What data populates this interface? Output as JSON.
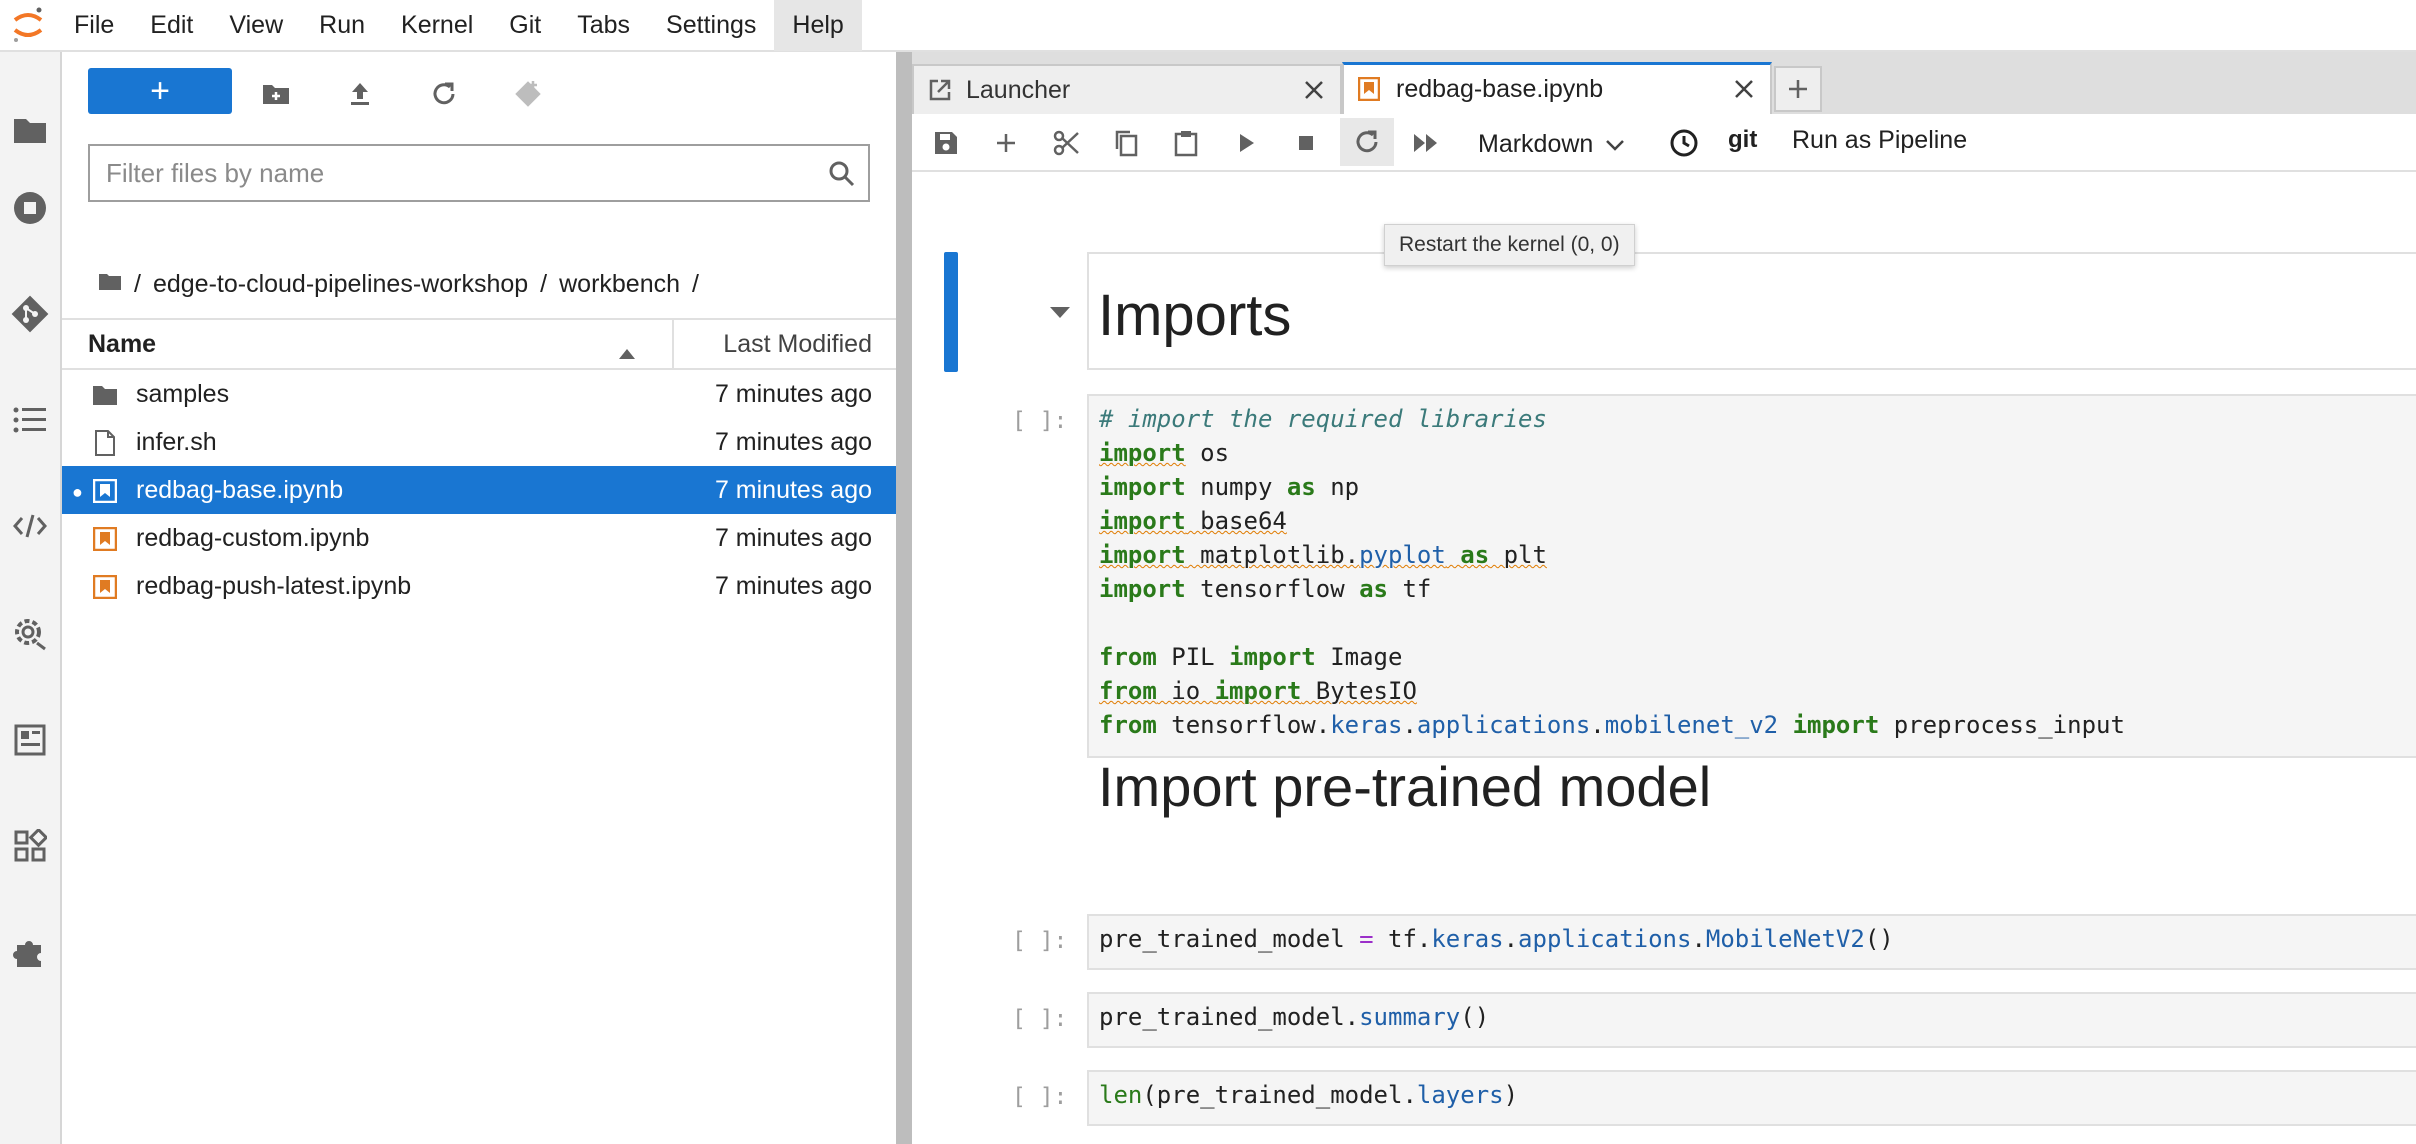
{
  "menubar": {
    "items": [
      "File",
      "Edit",
      "View",
      "Run",
      "Kernel",
      "Git",
      "Tabs",
      "Settings",
      "Help"
    ],
    "active": "Help"
  },
  "activitybar": {
    "icons": [
      "folder-icon",
      "stop-circle-icon",
      "git-icon",
      "list-icon",
      "code-icon",
      "settings-gear-icon",
      "component-catalog-icon",
      "pipeline-components-icon",
      "extension-puzzle-icon"
    ]
  },
  "filebrowser": {
    "new_label": "+",
    "filter_placeholder": "Filter files by name",
    "breadcrumb": [
      "edge-to-cloud-pipelines-workshop",
      "workbench"
    ],
    "header": {
      "name": "Name",
      "modified": "Last Modified"
    },
    "rows": [
      {
        "name": "samples",
        "modified": "7 minutes ago",
        "icon": "folder-icon",
        "selected": false
      },
      {
        "name": "infer.sh",
        "modified": "7 minutes ago",
        "icon": "file-icon",
        "selected": false
      },
      {
        "name": "redbag-base.ipynb",
        "modified": "7 minutes ago",
        "icon": "notebook-icon",
        "selected": true
      },
      {
        "name": "redbag-custom.ipynb",
        "modified": "7 minutes ago",
        "icon": "notebook-icon",
        "selected": false
      },
      {
        "name": "redbag-push-latest.ipynb",
        "modified": "7 minutes ago",
        "icon": "notebook-icon",
        "selected": false
      }
    ]
  },
  "tabs": [
    {
      "label": "Launcher",
      "active": false
    },
    {
      "label": "redbag-base.ipynb",
      "active": true
    }
  ],
  "notebook_toolbar": {
    "cell_type": "Markdown",
    "git_label": "git",
    "pipeline_label": "Run as Pipeline",
    "tooltip": "Restart the kernel (0, 0)"
  },
  "notebook": {
    "heading1": "Imports",
    "heading2": "Import pre-trained model",
    "prompt": "[ ]:",
    "cell1_comment": "# import the required libraries",
    "cell2_line": "pre_trained_model = tf.keras.applications.MobileNetV2()",
    "cell3_line": "pre_trained_model.summary()",
    "cell4_line": "len(pre_trained_model.layers)"
  },
  "colors": {
    "accent": "#1976d2",
    "notebook_orange": "#e07b22",
    "keyword_green": "#2a7a1a"
  }
}
